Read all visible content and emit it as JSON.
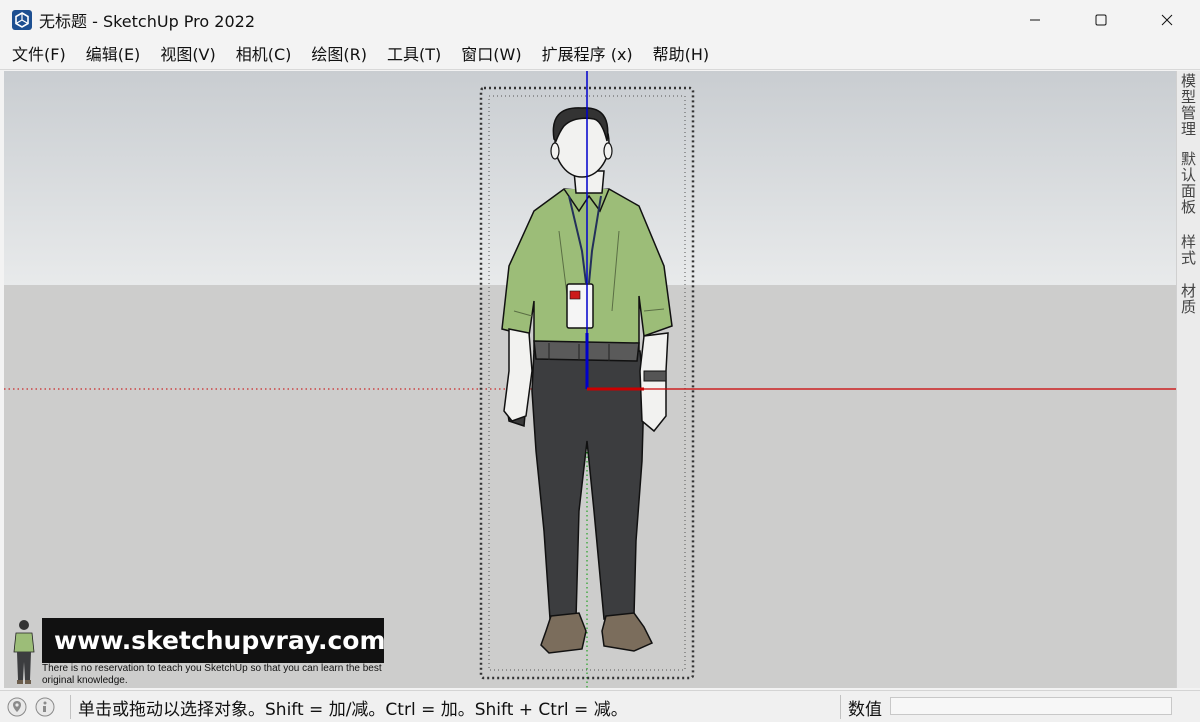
{
  "window": {
    "title": "无标题 - SketchUp Pro 2022"
  },
  "menu": {
    "items": [
      "文件(F)",
      "编辑(E)",
      "视图(V)",
      "相机(C)",
      "绘图(R)",
      "工具(T)",
      "窗口(W)",
      "扩展程序 (x)",
      "帮助(H)"
    ]
  },
  "tray": {
    "tabs": [
      "模型管理",
      "默认面板",
      "样式",
      "材质"
    ]
  },
  "watermark": {
    "url": "www.sketchupvray.com",
    "tagline": "There is no reservation to teach you SketchUp so that you can learn the best original knowledge."
  },
  "status": {
    "hint": "单击或拖动以选择对象。Shift = 加/减。Ctrl = 加。Shift + Ctrl = 减。",
    "measurements_label": "数值",
    "measurements_value": ""
  },
  "colors": {
    "sky_top": "#c9cdd1",
    "ground": "#cdcdcc",
    "axis_red": "#cc0000",
    "axis_blue": "#0000cc",
    "axis_green": "#009900",
    "shirt": "#9cbd78",
    "pants": "#3c3d3f"
  },
  "icons": {
    "app": "sketchup-icon",
    "minimize": "minimize-icon",
    "maximize": "maximize-icon",
    "close": "close-icon",
    "geo": "geo-location-icon",
    "info": "credits-icon"
  }
}
